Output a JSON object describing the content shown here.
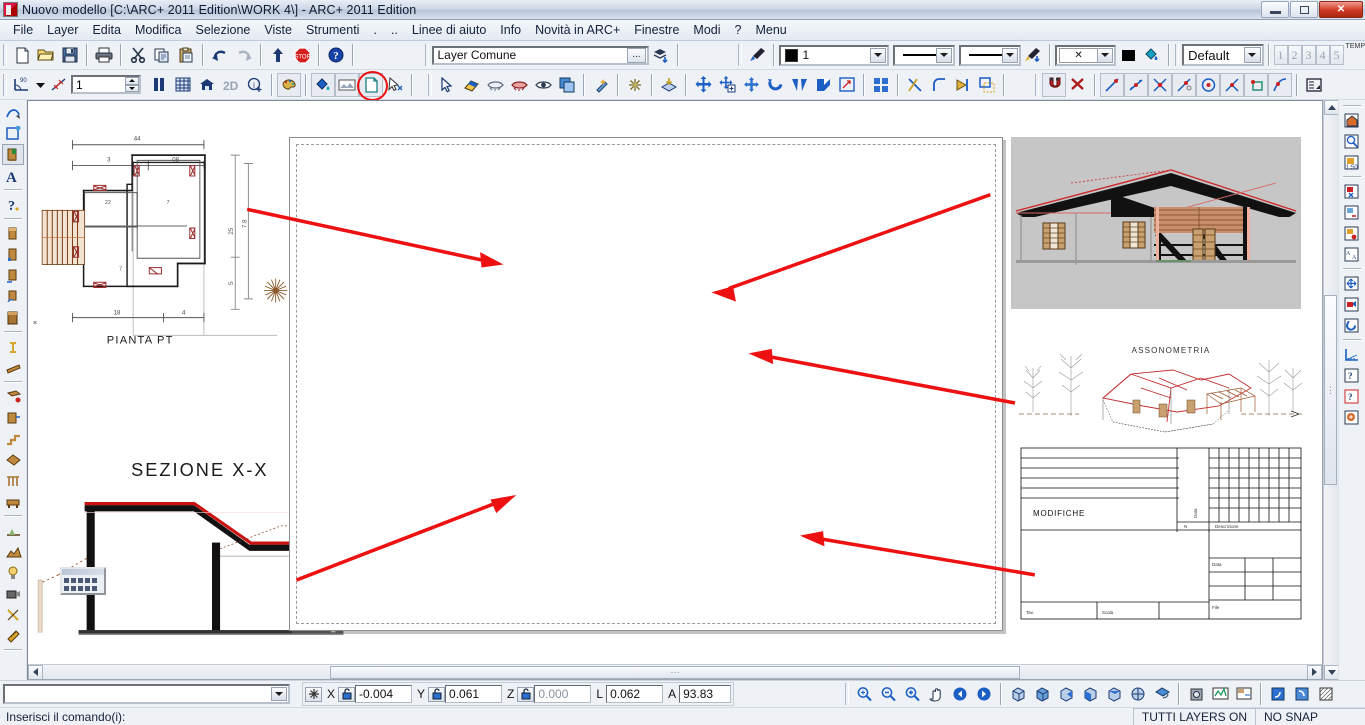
{
  "window": {
    "title": "Nuovo modello [C:\\ARC+ 2011 Edition\\WORK 4\\] - ARC+ 2011 Edition",
    "minimize_label": "Minimize",
    "restore_label": "Restore",
    "close_label": "✕"
  },
  "menu": {
    "items": [
      {
        "label": "File"
      },
      {
        "label": "Layer"
      },
      {
        "label": "Edita"
      },
      {
        "label": "Modifica"
      },
      {
        "label": "Selezione"
      },
      {
        "label": "Viste"
      },
      {
        "label": "Strumenti"
      },
      {
        "label": "."
      },
      {
        "label": ".."
      },
      {
        "label": "Linee di aiuto"
      },
      {
        "label": "Info"
      },
      {
        "label": "Novità in ARC+"
      },
      {
        "label": "Finestre"
      },
      {
        "label": "Modi"
      },
      {
        "label": "?"
      },
      {
        "label": "Menu"
      }
    ]
  },
  "toolbar_main": {
    "buttons": [
      {
        "name": "new-file-icon",
        "title": "Nuovo"
      },
      {
        "name": "open-folder-icon",
        "title": "Apri"
      },
      {
        "name": "save-floppy-icon",
        "title": "Salva"
      },
      {
        "name": "print-icon",
        "title": "Stampa"
      },
      {
        "name": "cut-scissors-icon",
        "title": "Taglia"
      },
      {
        "name": "copy-icon",
        "title": "Copia"
      },
      {
        "name": "paste-clipboard-icon",
        "title": "Incolla"
      },
      {
        "name": "undo-arrow-icon",
        "title": "Annulla"
      },
      {
        "name": "redo-arrow-icon",
        "title": "Ripeti"
      },
      {
        "name": "up-arrow-icon",
        "title": "Su"
      },
      {
        "name": "stop-sign-icon",
        "title": "Stop"
      },
      {
        "name": "help-question-icon",
        "title": "Aiuto"
      }
    ],
    "layer_field": {
      "value": "Layer Comune",
      "browse_label": "..."
    },
    "layer_stack_icon": "layer-stack-icon",
    "pen_pick_icon": "pen-pick-icon",
    "pen": {
      "value": "1"
    },
    "linetype": {
      "value": ""
    },
    "lineweight": {
      "value": ""
    },
    "pen_down_icon": "pen-down-icon",
    "hatch": {
      "value": "✕"
    },
    "fill_color_swatch": "#000000",
    "paint_bucket_icon": "paint-bucket-icon",
    "style": {
      "value": "Default"
    },
    "view_numbers": [
      "1",
      "2",
      "3",
      "4",
      "5"
    ],
    "temp_label": "TEMP"
  },
  "toolbar_second": {
    "angle_icon": "angle-90-icon",
    "angle_dropdown_icon": "chevron-down-icon",
    "ortho_icon": "ortho-cross-icon",
    "scale": {
      "value": "1"
    },
    "buttons": [
      {
        "name": "pause-bars-icon"
      },
      {
        "name": "grid-icon"
      },
      {
        "name": "home-icon"
      },
      {
        "name": "2d-mode-icon"
      },
      {
        "name": "info-plus-icon"
      },
      {
        "name": "palette-icon"
      },
      {
        "name": "fill-bucket-icon"
      },
      {
        "name": "image-frame-icon"
      },
      {
        "name": "new-sheet-icon"
      },
      {
        "name": "pointer-tag-icon"
      },
      {
        "name": "select-arrow-icon"
      },
      {
        "name": "eraser-icon"
      },
      {
        "name": "hide-eye-icon"
      },
      {
        "name": "show-eye-red-icon"
      },
      {
        "name": "eye-icon"
      },
      {
        "name": "duplicate-layers-icon"
      },
      {
        "name": "wand-icon"
      },
      {
        "name": "explode-icon"
      },
      {
        "name": "stack-arrow-icon"
      },
      {
        "name": "move-cross-icon"
      },
      {
        "name": "copy-move-icon"
      },
      {
        "name": "move-free-icon"
      },
      {
        "name": "rotate-icon"
      },
      {
        "name": "mirror-icon"
      },
      {
        "name": "flip-corner-icon"
      },
      {
        "name": "scale-box-icon"
      },
      {
        "name": "array-grid-icon"
      },
      {
        "name": "trim-line-icon"
      },
      {
        "name": "fillet-icon"
      },
      {
        "name": "extend-icon"
      },
      {
        "name": "offset-box-icon"
      }
    ],
    "snap_buttons": [
      {
        "name": "magnet-snap-icon"
      },
      {
        "name": "snap-off-icon"
      },
      {
        "name": "snap-endpoint-icon"
      },
      {
        "name": "snap-midpoint-icon"
      },
      {
        "name": "snap-intersection-icon"
      },
      {
        "name": "snap-perpendicular-icon"
      },
      {
        "name": "snap-center-icon"
      },
      {
        "name": "snap-node-icon"
      },
      {
        "name": "snap-nearest-icon"
      },
      {
        "name": "snap-tangent-icon"
      },
      {
        "name": "snap-settings-icon"
      }
    ]
  },
  "sidebar_left": {
    "items": [
      {
        "name": "curve-tool-icon"
      },
      {
        "name": "polyline-tool-icon"
      },
      {
        "name": "hatch-tool-icon"
      },
      {
        "name": "text-tool-icon"
      },
      {
        "name": "dim-question-icon"
      },
      {
        "name": "wall-tool-icon"
      },
      {
        "name": "wall-corner-icon"
      },
      {
        "name": "wall-join-icon"
      },
      {
        "name": "wall-curve-icon"
      },
      {
        "name": "wall-solid-icon"
      },
      {
        "name": "column-icon"
      },
      {
        "name": "beam-icon"
      },
      {
        "name": "slab-icon"
      },
      {
        "name": "door-window-icon"
      },
      {
        "name": "stair-icon"
      },
      {
        "name": "roof-icon"
      },
      {
        "name": "railing-icon"
      },
      {
        "name": "furniture-icon"
      },
      {
        "name": "site-icon"
      },
      {
        "name": "terrain-icon"
      },
      {
        "name": "light-icon"
      },
      {
        "name": "camera-icon"
      },
      {
        "name": "render-icon"
      },
      {
        "name": "measure-tool-icon"
      }
    ]
  },
  "sidebar_right": {
    "items": [
      {
        "name": "view-home-icon"
      },
      {
        "name": "zoom-window-icon"
      },
      {
        "name": "scale-1-50-icon"
      },
      {
        "name": "view-save-icon"
      },
      {
        "name": "view-delete-icon"
      },
      {
        "name": "view-lock-icon"
      },
      {
        "name": "view-rename-icon"
      },
      {
        "name": "view-pan-icon"
      },
      {
        "name": "view-camera-icon"
      },
      {
        "name": "view-rotate-icon"
      },
      {
        "name": "dimension-icon"
      },
      {
        "name": "help-view-icon"
      },
      {
        "name": "help-view-2-icon"
      },
      {
        "name": "render-view-icon"
      }
    ]
  },
  "drawing": {
    "plan_label": "PIANTA PT",
    "section_label": "SEZIONE X-X",
    "axonometry_label": "ASSONOMETRIA",
    "titleblock": {
      "modifiche_label": "MODIFICHE",
      "col_labels": [
        "N",
        "Descrizione",
        "Data",
        "File",
        "Tav.",
        "Scala"
      ]
    },
    "plan_dims": {
      "top_total": "44",
      "top_left": "3",
      "top_right": "08",
      "bottom_left": "18",
      "bottom_right": "4",
      "right_total": "25",
      "right_upper": "7.8",
      "right_lower": "5",
      "room_a": "7",
      "room_b": "22",
      "room_c": "7"
    }
  },
  "command_bar": {
    "input_value": "",
    "coord_marker_icon": "snap-star-icon",
    "fields": [
      {
        "label": "X",
        "value": "-0.004",
        "locked": false,
        "dim": false
      },
      {
        "label": "Y",
        "value": "0.061",
        "locked": false,
        "dim": false
      },
      {
        "label": "Z",
        "value": "0.000",
        "locked": false,
        "dim": true
      },
      {
        "label": "L",
        "value": "0.062",
        "locked": null,
        "dim": false
      },
      {
        "label": "A",
        "value": "93.83",
        "locked": null,
        "dim": false
      }
    ],
    "view_buttons": [
      {
        "name": "zoom-all-icon"
      },
      {
        "name": "zoom-out-icon"
      },
      {
        "name": "zoom-in-icon"
      },
      {
        "name": "pan-hand-icon"
      },
      {
        "name": "zoom-previous-icon"
      },
      {
        "name": "zoom-next-icon"
      },
      {
        "name": "view-3d-1-icon"
      },
      {
        "name": "view-3d-2-icon"
      },
      {
        "name": "view-3d-3-icon"
      },
      {
        "name": "view-3d-4-icon"
      },
      {
        "name": "view-3d-5-icon"
      },
      {
        "name": "view-axono-icon"
      },
      {
        "name": "view-shade-icon"
      },
      {
        "name": "render-camera-icon"
      },
      {
        "name": "chart-icon"
      },
      {
        "name": "layout-icon"
      },
      {
        "name": "window-blue-icon"
      },
      {
        "name": "window-blue-2-icon"
      },
      {
        "name": "hatch-pattern-icon"
      }
    ]
  },
  "statusbar": {
    "message": "Inserisci il comando(i):",
    "layers_state": "TUTTI LAYERS ON",
    "snap_state": "NO SNAP"
  },
  "colors": {
    "annotation_red": "#ee1111",
    "roof_red": "#cc2222",
    "wood_brown": "#8a5a33",
    "viewport_gray": "#c6c6c6"
  }
}
